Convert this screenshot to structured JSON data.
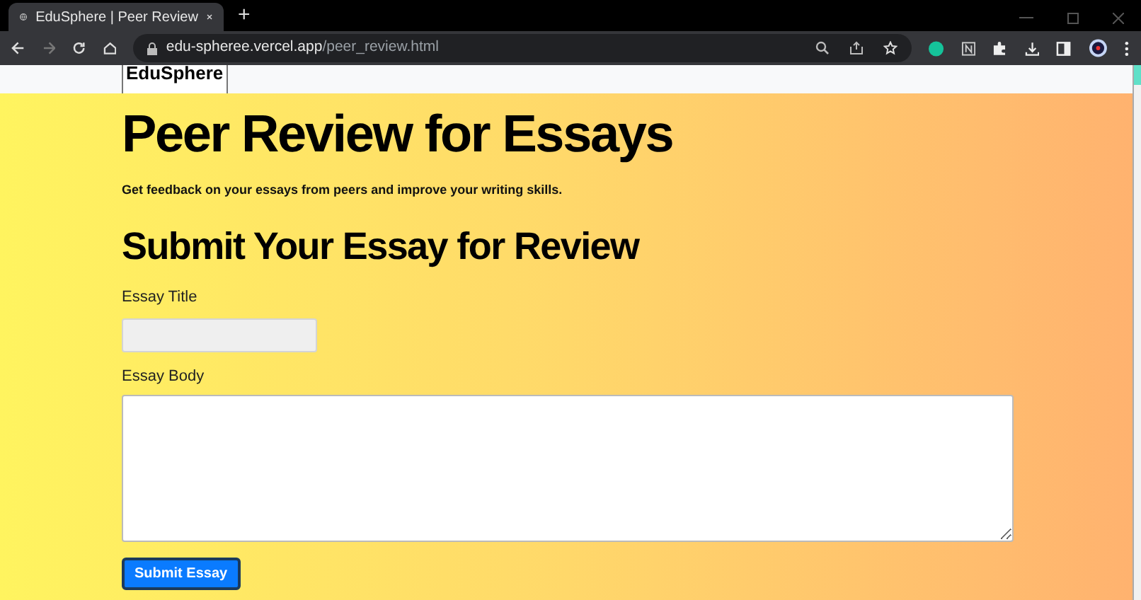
{
  "browser": {
    "tab_title": "EduSphere | Peer Review",
    "new_tab": "+",
    "url_host": "edu-spheree.vercel.app",
    "url_path": "/peer_review.html"
  },
  "nav": {
    "logo": "EduSphere"
  },
  "page": {
    "title": "Peer Review for Essays",
    "subtitle": "Get feedback on your essays from peers and improve your writing skills."
  },
  "form": {
    "heading": "Submit Your Essay for Review",
    "fields": [
      {
        "kind": "input",
        "label": "Essay Title"
      },
      {
        "kind": "textarea",
        "label": "Essay Body"
      }
    ],
    "submit": "Submit Essay"
  }
}
